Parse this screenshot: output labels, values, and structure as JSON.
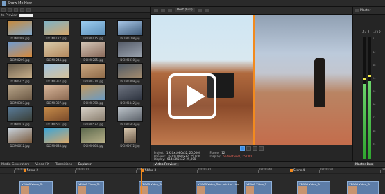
{
  "window": {
    "title": "Show Me How"
  },
  "explorer": {
    "filter_label": "to Preview",
    "thumbnails": [
      {
        "name": "DCIM0088.jpg",
        "colors": [
          "#c98a3a",
          "#7fa9d0"
        ]
      },
      {
        "name": "DCIM0127.jpg",
        "colors": [
          "#7db4c8",
          "#d6a76a"
        ]
      },
      {
        "name": "DCIM0175.jpg",
        "colors": [
          "#9ccdf0",
          "#5d8fb8"
        ]
      },
      {
        "name": "DCIM0198.jpg",
        "colors": [
          "#a8c7e8",
          "#3e5a78"
        ]
      },
      {
        "name": "DCIM0209.jpg",
        "colors": [
          "#6f9bd0",
          "#d68a3c"
        ]
      },
      {
        "name": "DCIM0244.jpg",
        "colors": [
          "#d8c9a8",
          "#b58a5e"
        ]
      },
      {
        "name": "DCIM0285.jpg",
        "colors": [
          "#d2c4b6",
          "#8a6a5a"
        ]
      },
      {
        "name": "DCIM0310.jpg",
        "colors": [
          "#565d6a",
          "#9aa2ae"
        ]
      },
      {
        "name": "DCIM0325.jpg",
        "colors": [
          "#6a5e4e",
          "#c9b08a"
        ]
      },
      {
        "name": "DCIM0352.jpg",
        "colors": [
          "#9fc3e0",
          "#d6c29a"
        ]
      },
      {
        "name": "DCIM0374.jpg",
        "colors": [
          "#caa882",
          "#8f6a48"
        ]
      },
      {
        "name": "DCIM0399.jpg",
        "colors": [
          "#4f5a66",
          "#a58c6e"
        ]
      },
      {
        "name": "DCIM0387.jpg",
        "colors": [
          "#b9a68a",
          "#6d5a46"
        ]
      },
      {
        "name": "DCIM0387.jpg",
        "colors": [
          "#d8b69a",
          "#8c6a52"
        ]
      },
      {
        "name": "DCIM0390.jpg",
        "colors": [
          "#c29a62",
          "#6a9ac2"
        ]
      },
      {
        "name": "DCIM0442.jpg",
        "colors": [
          "#6e7480",
          "#2e3440"
        ]
      },
      {
        "name": "DCIM0478.jpg",
        "colors": [
          "#5a7d9c",
          "#3a3e36"
        ]
      },
      {
        "name": "DCIM0501.jpg",
        "colors": [
          "#c68c4a",
          "#7a4a2a"
        ]
      },
      {
        "name": "DCIM0532.jpg",
        "colors": [
          "#d8d2c8",
          "#8a7e6e"
        ]
      },
      {
        "name": "DCIM0583.jpg",
        "colors": [
          "#bfc6cc",
          "#5a6068"
        ]
      },
      {
        "name": "DCIM0612.jpg",
        "colors": [
          "#c9d4de",
          "#7a5a3c"
        ]
      },
      {
        "name": "DCIM0633.jpg",
        "colors": [
          "#3aa5d8",
          "#d8a86a"
        ]
      },
      {
        "name": "DCIM0664.jpg",
        "colors": [
          "#5d6a4e",
          "#b8b088"
        ]
      },
      {
        "name": "DCIM0672.jpg",
        "colors": [
          "#d8c8b0",
          "#6c5a48"
        ]
      }
    ]
  },
  "left_tabs": [
    "Media Generators",
    "Video FX",
    "Transitions",
    "Explorer"
  ],
  "preview": {
    "quality": "Best (Full)",
    "info": {
      "project_label": "Project:",
      "project_value": "1920x1080x32, 25,000i",
      "preview_label": "Preview:",
      "preview_value": "1920x1080x32, 25,000",
      "display_label": "Display:",
      "display_value": "614x345x32, 25,000",
      "frame_label": "Frame:",
      "frame_value": "12",
      "display2_label": "Display:",
      "display2_value": "614x345x32, 25,000"
    },
    "tab": "Video Preview"
  },
  "master": {
    "label": "Master",
    "left_value": "-14.7",
    "right_value": "-13.2",
    "scale": [
      "6",
      "12",
      "18",
      "24",
      "30",
      "36",
      "42",
      "48",
      "54"
    ],
    "level_left": 0.62,
    "level_right": 0.64,
    "tab": "Master Bus"
  },
  "timeline": {
    "ruler_labels": [
      "00:00:00",
      "00:00:10",
      "00:00:20",
      "00:00:30",
      "00:00:40",
      "00:00:50",
      "00:01:00"
    ],
    "markers": [
      "Scene 2",
      "Scene 3",
      "Scene 4"
    ],
    "clips": [
      "VEGAS Video_Te",
      "VEGAS Video_Te",
      "VEGAS Video_Te",
      "VEGAS Video_Text point of view",
      "VEGAS Video_T",
      "VEGAS Video_Te",
      "VEGAS Video_Te"
    ]
  },
  "colors": {
    "accent": "#f28a1e",
    "play": "#3d8de0",
    "meter": "#2fa52f",
    "clip": "#5d7da8"
  }
}
